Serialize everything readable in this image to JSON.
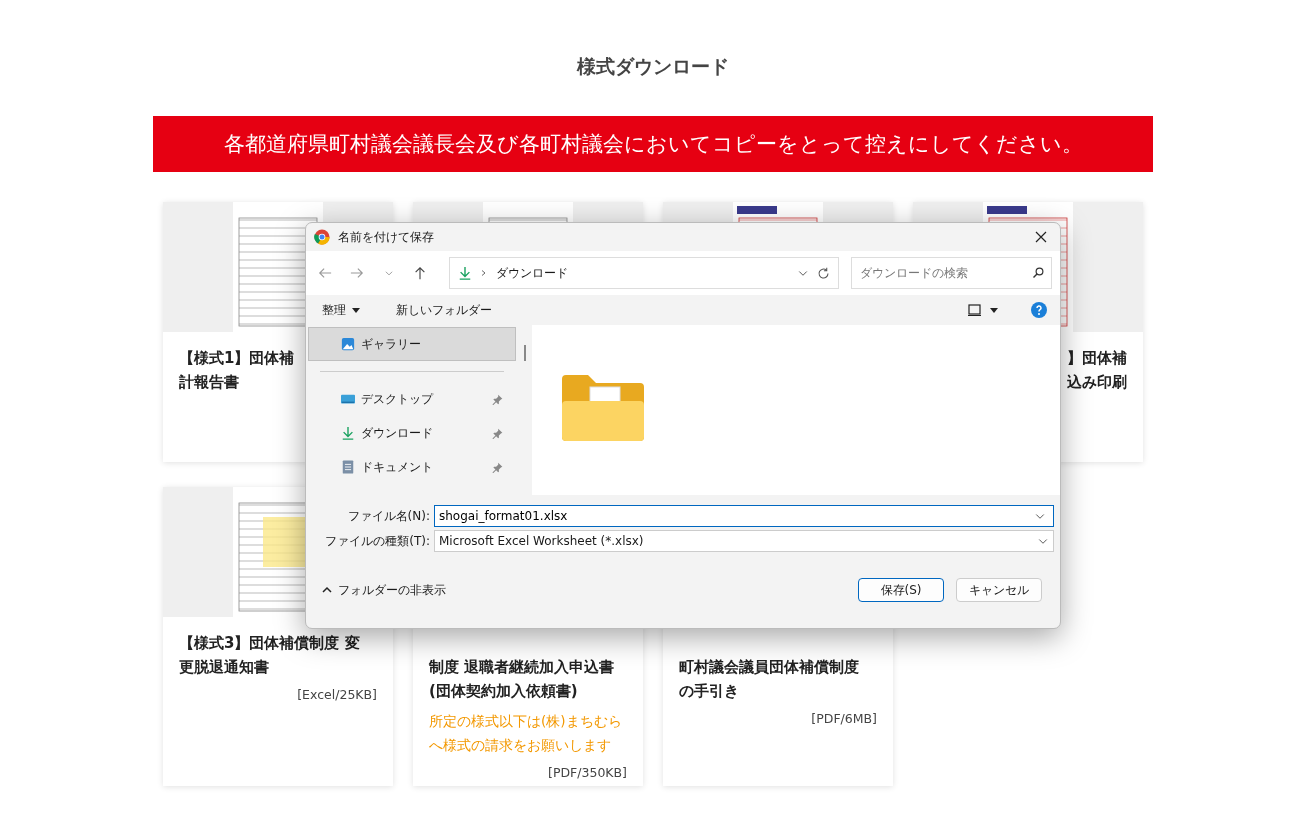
{
  "page_title": "様式ダウンロード",
  "banner": "各都道府県町村議会議長会及び各町村議会においてコピーをとって控えにしてください。",
  "cards": [
    {
      "kind": "left",
      "title_lines": [
        "【様式1】団体補",
        "計報告書"
      ]
    },
    {
      "kind": "hidden"
    },
    {
      "kind": "hidden"
    },
    {
      "kind": "right",
      "title_lines": [
        "】団体補",
        "込み印刷"
      ]
    },
    {
      "kind": "left",
      "title_lines": [
        "【様式3】団体補償制度 変",
        "更脱退通知書"
      ],
      "size": "[Excel/25KB]"
    },
    {
      "kind": "left",
      "title_lines": [
        "制度 退職者継続加入申込書",
        "(団体契約加入依頼書)"
      ],
      "note": "所定の様式以下は(株)まちむらへ様式の請求をお願いします",
      "size": "[PDF/350KB]"
    },
    {
      "kind": "left",
      "title_lines": [
        "町村議会議員団体補償制度",
        "の手引き"
      ],
      "size": "[PDF/6MB]"
    }
  ],
  "dialog": {
    "title": "名前を付けて保存",
    "path": "ダウンロード",
    "search": {
      "placeholder": "ダウンロードの検索"
    },
    "toolbar": {
      "organize": "整理",
      "new_folder": "新しいフォルダー"
    },
    "nav_items": [
      {
        "kind": "gallery",
        "label": "ギャラリー",
        "selected": true
      },
      {
        "kind": "desktop",
        "label": "デスクトップ",
        "selected": false
      },
      {
        "kind": "download",
        "label": "ダウンロード",
        "selected": false
      },
      {
        "kind": "document",
        "label": "ドキュメント",
        "selected": false
      }
    ],
    "file_name_label": "ファイル名(N):",
    "file_name": "shogai_format01.xlsx",
    "file_type_label": "ファイルの種類(T):",
    "file_type": "Microsoft Excel Worksheet (*.xlsx)",
    "hide_folders": "フォルダーの非表示",
    "save": "保存(S)",
    "cancel": "キャンセル"
  }
}
